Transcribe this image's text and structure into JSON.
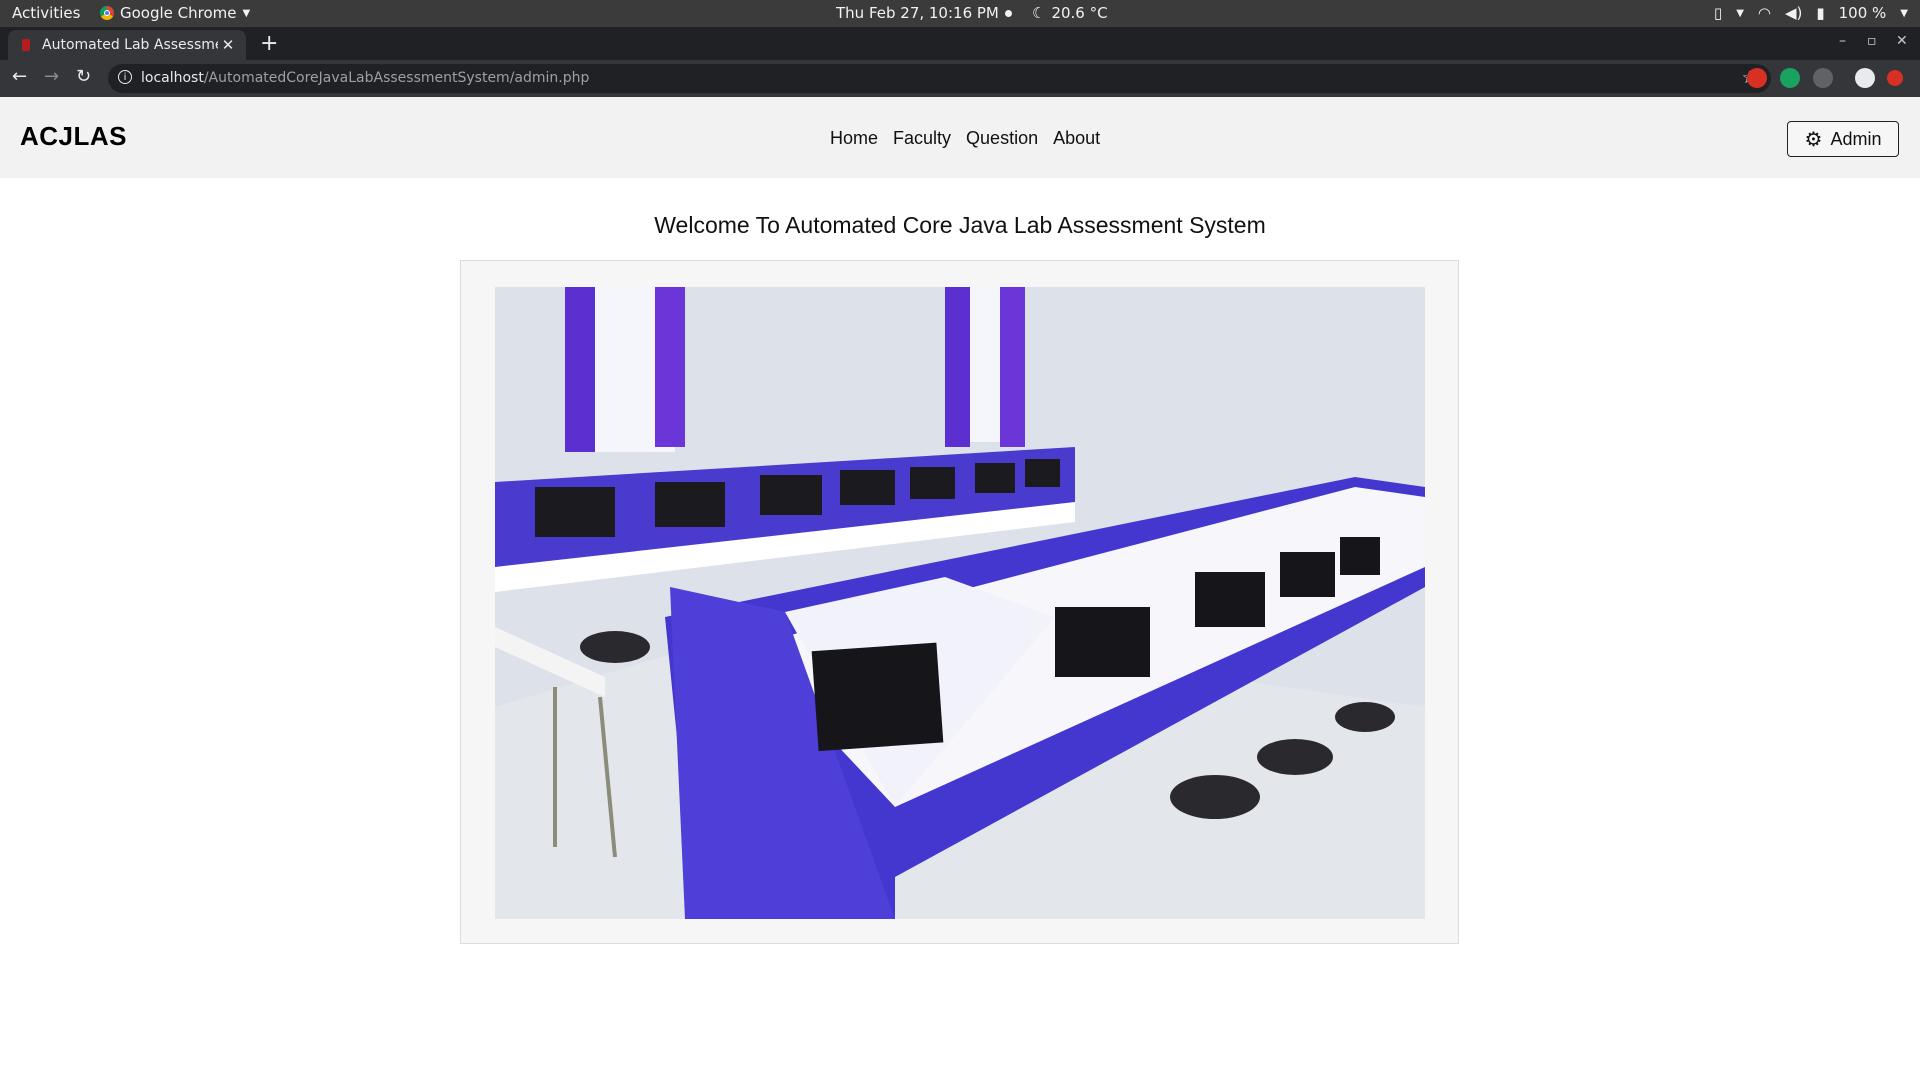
{
  "os_bar": {
    "activities": "Activities",
    "app_name": "Google Chrome",
    "clock": "Thu Feb 27, 10:16 PM",
    "weather": "20.6 °C",
    "battery": "100 %"
  },
  "browser": {
    "tab_title": "Automated Lab Assessme",
    "url_host": "localhost",
    "url_path": "/AutomatedCoreJavaLabAssessmentSystem/admin.php"
  },
  "site": {
    "brand": "ACJLAS",
    "nav": [
      "Home",
      "Faculty",
      "Question",
      "About"
    ],
    "admin_button": "Admin",
    "heading": "Welcome To Automated Core Java Lab Assessment System"
  },
  "colors": {
    "cubicle_blue": "#4b3fd0",
    "navbar_bg": "#f2f2f2"
  }
}
